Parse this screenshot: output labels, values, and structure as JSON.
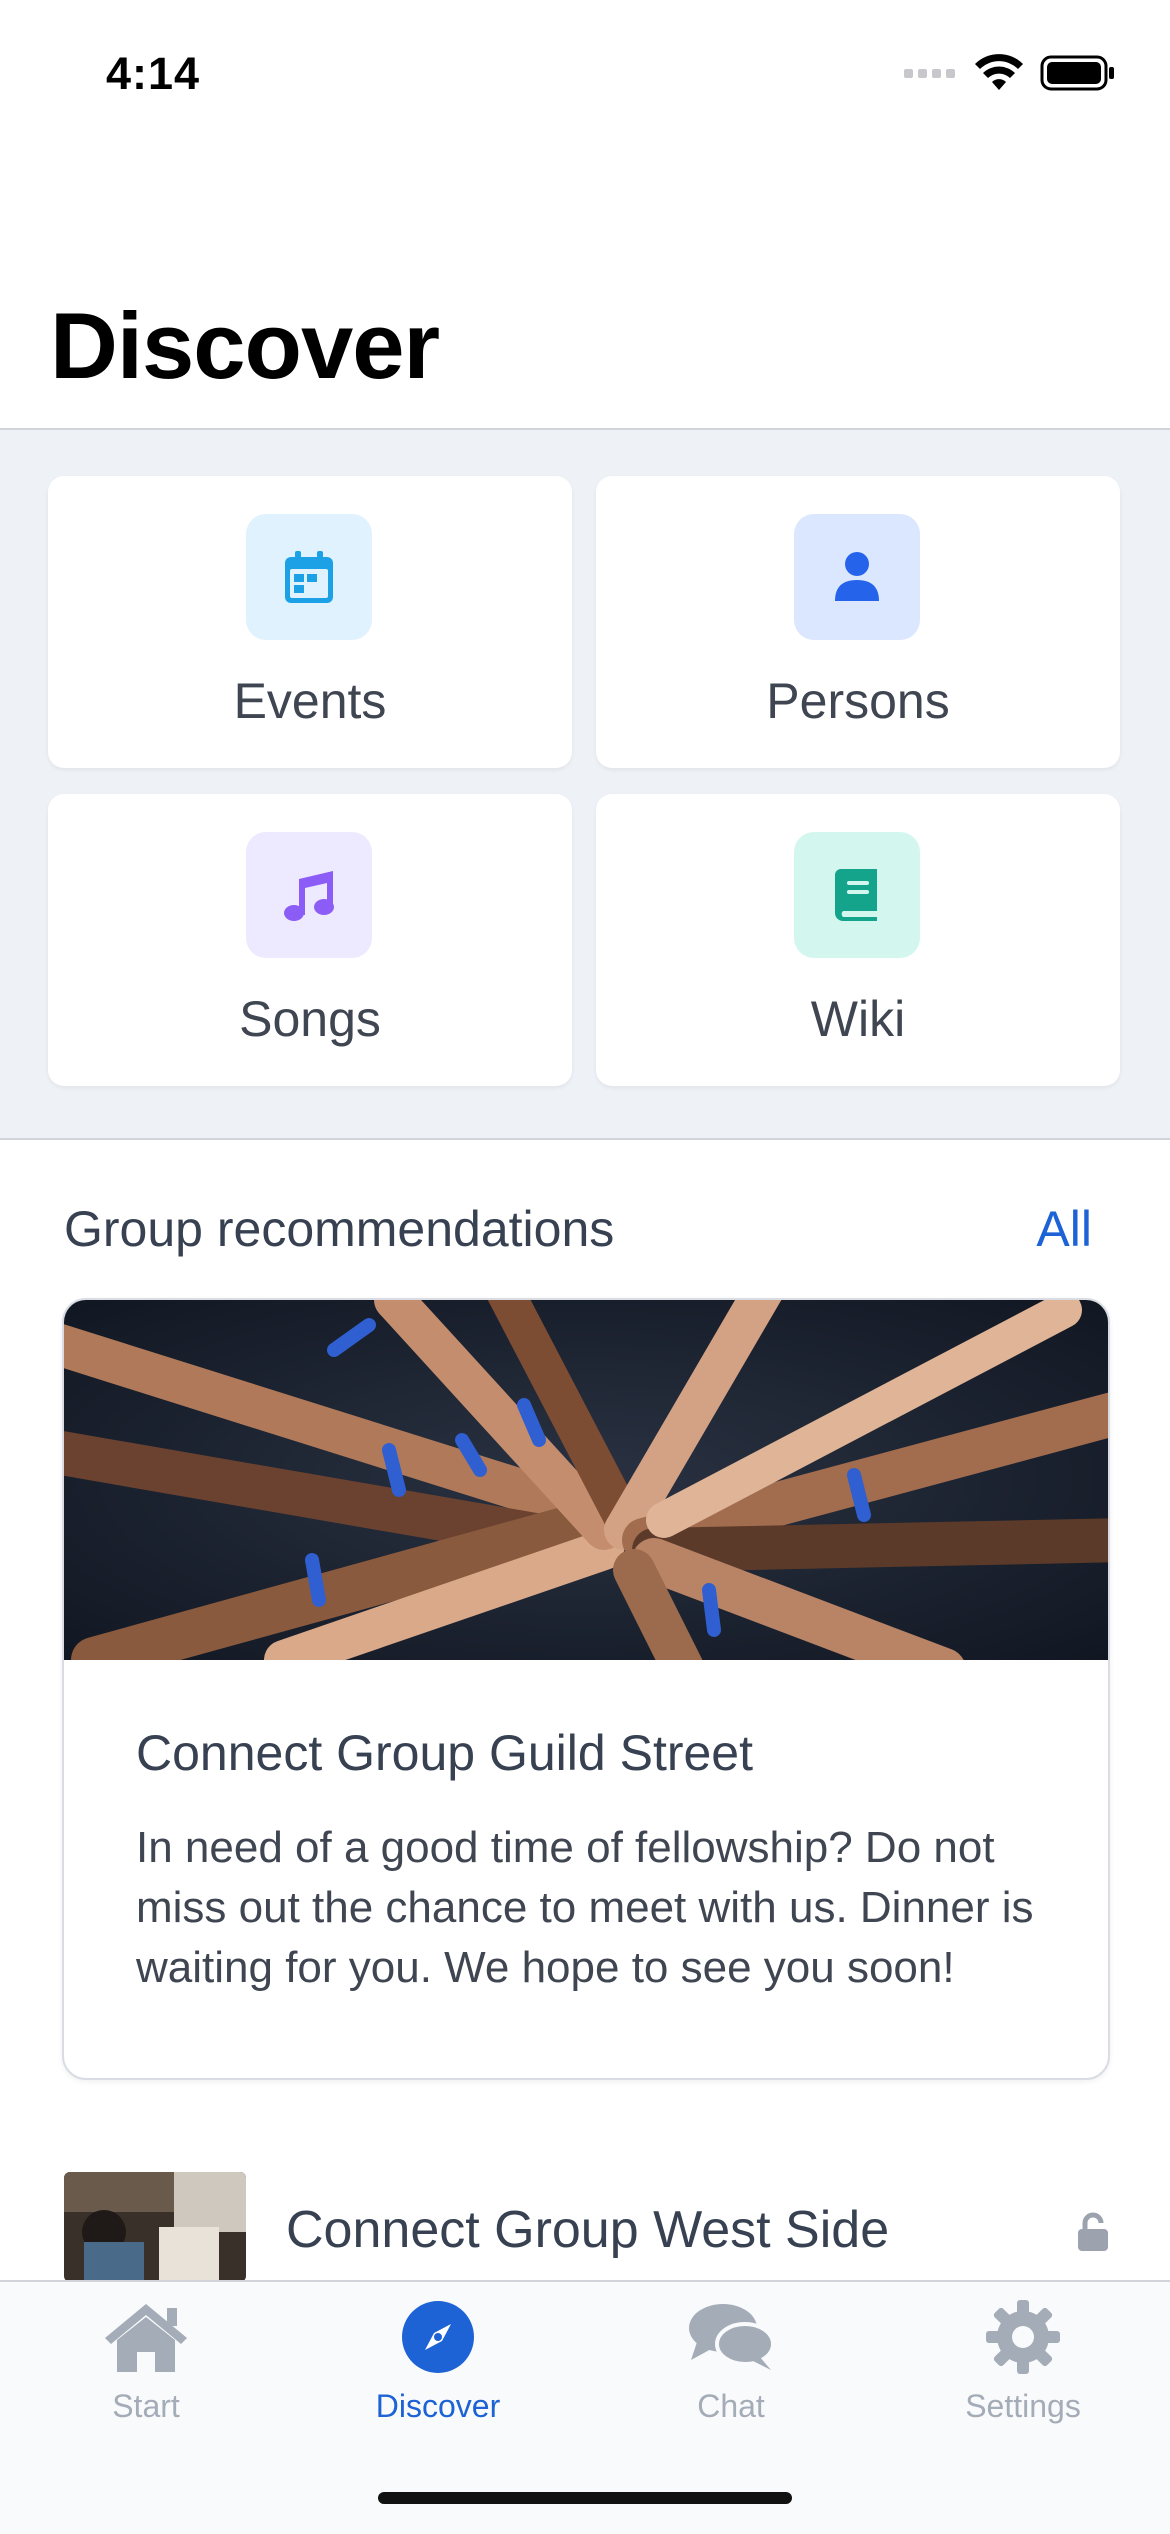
{
  "status_bar": {
    "time": "4:14"
  },
  "header": {
    "title": "Discover"
  },
  "grid": {
    "items": [
      {
        "label": "Events",
        "icon": "calendar-icon",
        "icon_color": "#1da1e6",
        "bg": "#e0f2fe"
      },
      {
        "label": "Persons",
        "icon": "person-icon",
        "icon_color": "#2563eb",
        "bg": "#dbe7fe"
      },
      {
        "label": "Songs",
        "icon": "music-note-icon",
        "icon_color": "#8b5cf6",
        "bg": "#ede9fe"
      },
      {
        "label": "Wiki",
        "icon": "book-icon",
        "icon_color": "#14a38b",
        "bg": "#d3f7ee"
      }
    ]
  },
  "recommendations": {
    "title": "Group recommendations",
    "all_label": "All",
    "featured": {
      "title": "Connect Group Guild Street",
      "description": "In need of a good time of fellowship? Do not miss out the chance to meet with us. Dinner is waiting for you. We hope to see you soon!"
    },
    "list": [
      {
        "title": "Connect Group West Side",
        "icon": "unlock-icon"
      }
    ]
  },
  "tab_bar": {
    "tabs": [
      {
        "label": "Start",
        "icon": "home-icon",
        "active": false
      },
      {
        "label": "Discover",
        "icon": "compass-icon",
        "active": true
      },
      {
        "label": "Chat",
        "icon": "chat-bubbles-icon",
        "active": false
      },
      {
        "label": "Settings",
        "icon": "gear-icon",
        "active": false
      }
    ]
  },
  "colors": {
    "accent": "#1d63d6",
    "grid_bg": "#eef2f6",
    "inactive": "#a4acb8"
  }
}
